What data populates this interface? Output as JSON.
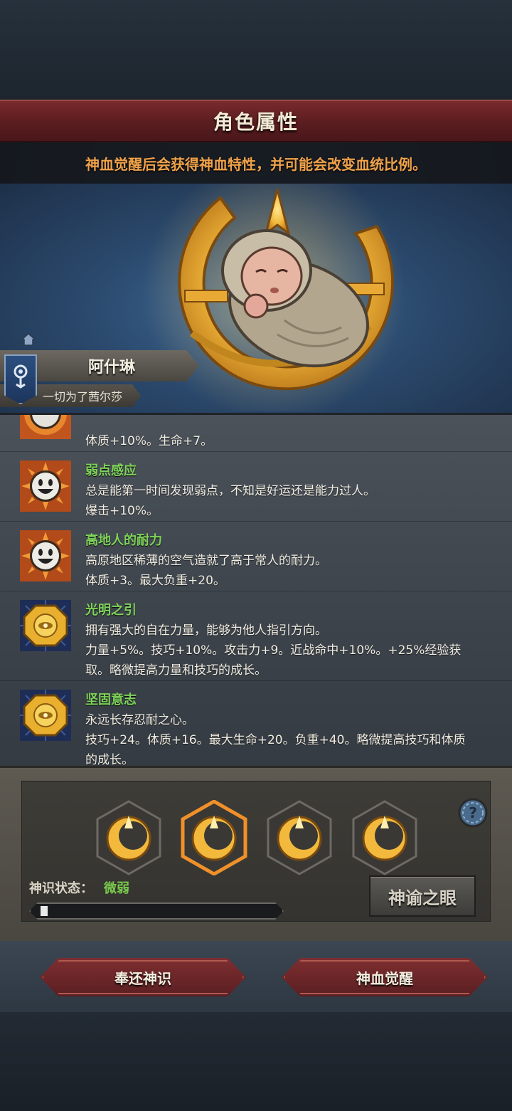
{
  "header": {
    "title": "角色属性",
    "notice": "神血觉醒后会获得神血特性，并可能会改变血统比例。"
  },
  "character": {
    "name": "阿什琳",
    "subtitle": "一切为了茜尔莎"
  },
  "traits": [
    {
      "name": "",
      "lines": [
        "体质+10%。生命+7。"
      ],
      "icon": "sun-face-icon"
    },
    {
      "name": "弱点感应",
      "lines": [
        "总是能第一时间发现弱点，不知是好运还是能力过人。",
        "爆击+10%。"
      ],
      "icon": "sun-face-icon"
    },
    {
      "name": "高地人的耐力",
      "lines": [
        "高原地区稀薄的空气造就了高于常人的耐力。",
        "体质+3。最大负重+20。"
      ],
      "icon": "sun-face-icon"
    },
    {
      "name": "光明之引",
      "lines": [
        "拥有强大的自在力量，能够为他人指引方向。",
        "力量+5%。技巧+10%。攻击力+9。近战命中+10%。+25%经验获",
        "取。略微提高力量和技巧的成长。"
      ],
      "icon": "gold-eye-emblem-icon"
    },
    {
      "name": "坚固意志",
      "lines": [
        "永远长存忍耐之心。",
        "技巧+24。体质+16。最大生命+20。负重+40。略微提高技巧和体质",
        "的成长。"
      ],
      "icon": "gold-eye-emblem-icon"
    }
  ],
  "divine_sense": {
    "label": "神识状态：",
    "value": "微弱",
    "progress": 0.03,
    "oracle_button": "神谕之眼"
  },
  "footer": {
    "return_button": "奉还神识",
    "awaken_button": "神血觉醒"
  },
  "colors": {
    "accent_green": "#7ed25a",
    "notice_orange": "#f0a24a",
    "title_red": "#6a2427",
    "slot_highlight": "#f0902a"
  }
}
